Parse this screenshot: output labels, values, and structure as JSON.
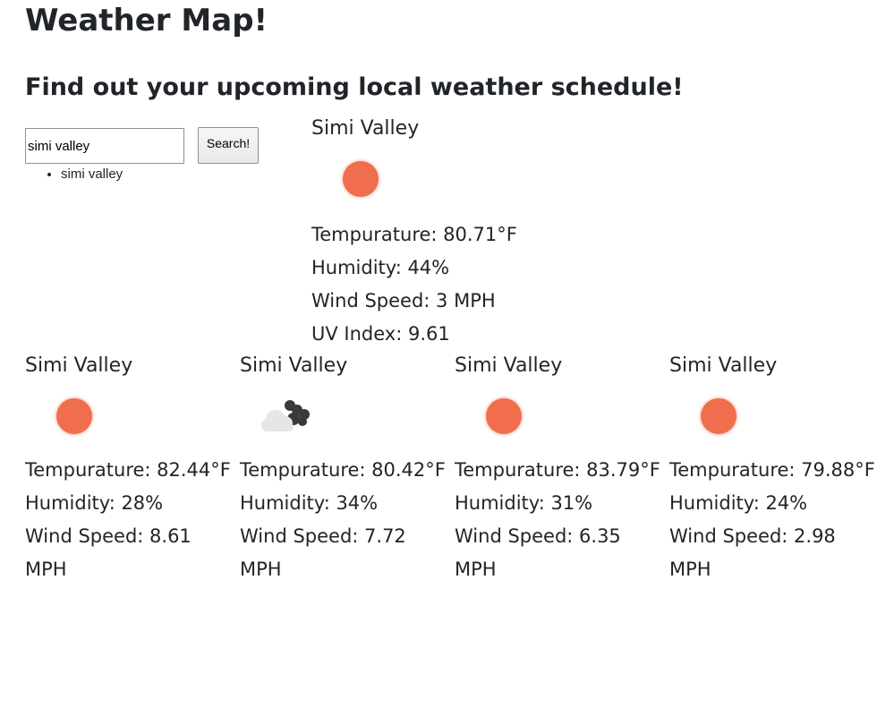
{
  "header": {
    "title": "Weather Map!",
    "subtitle": "Find out your upcoming local weather schedule!"
  },
  "search": {
    "value": "simi valley",
    "button_label": "Search!"
  },
  "history": [
    "simi valley"
  ],
  "current": {
    "city": "Simi Valley",
    "icon": "sun-icon",
    "temperature": "Tempurature: 80.71°F",
    "humidity": "Humidity: 44%",
    "wind": "Wind Speed: 3 MPH",
    "uv": "UV Index: 9.61"
  },
  "forecast": [
    {
      "city": "Simi Valley",
      "icon": "sun-icon",
      "temperature": "Tempurature: 82.44°F",
      "humidity": "Humidity: 28%",
      "wind": "Wind Speed: 8.61 MPH"
    },
    {
      "city": "Simi Valley",
      "icon": "partly-cloudy-icon",
      "temperature": "Tempurature: 80.42°F",
      "humidity": "Humidity: 34%",
      "wind": "Wind Speed: 7.72 MPH"
    },
    {
      "city": "Simi Valley",
      "icon": "sun-icon",
      "temperature": "Tempurature: 83.79°F",
      "humidity": "Humidity: 31%",
      "wind": "Wind Speed: 6.35 MPH"
    },
    {
      "city": "Simi Valley",
      "icon": "sun-icon",
      "temperature": "Tempurature: 79.88°F",
      "humidity": "Humidity: 24%",
      "wind": "Wind Speed: 2.98 MPH"
    }
  ],
  "colors": {
    "sun": "#f06e4e",
    "cloud_light": "#e8e8e8",
    "cloud_dark": "#3a3a3a"
  }
}
